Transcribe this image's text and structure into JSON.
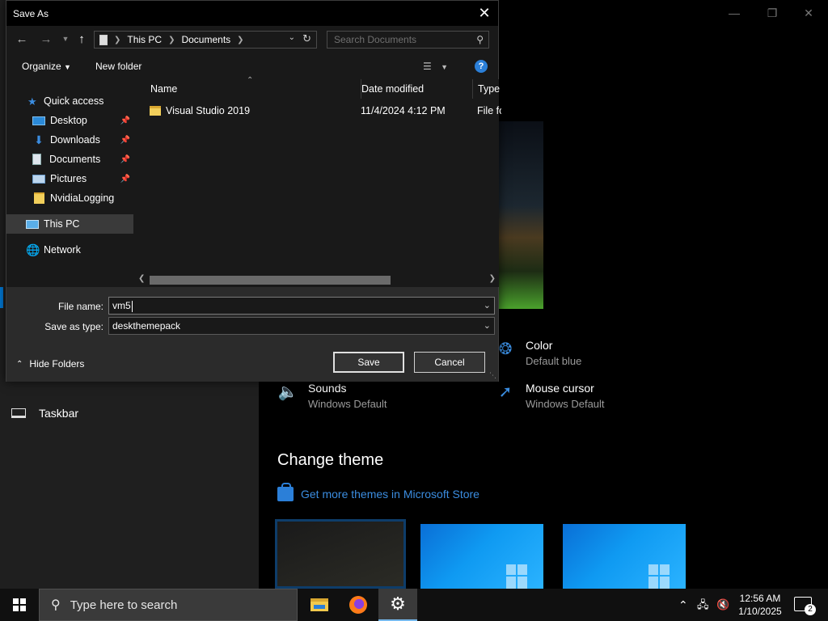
{
  "settings": {
    "nav": {
      "taskbar_label": "Taskbar"
    },
    "color": {
      "title": "Color",
      "value": "Default blue"
    },
    "sounds": {
      "title": "Sounds",
      "value": "Windows Default"
    },
    "mouse_cursor": {
      "title": "Mouse cursor",
      "value": "Windows Default"
    },
    "change_theme_heading": "Change theme",
    "store_link": "Get more themes in Microsoft Store"
  },
  "dialog": {
    "title": "Save As",
    "breadcrumb": [
      "This PC",
      "Documents"
    ],
    "search_placeholder": "Search Documents",
    "toolbar": {
      "organize": "Organize",
      "new_folder": "New folder",
      "help": "?"
    },
    "nav_pane": [
      {
        "label": "Quick access",
        "icon": "star-icon"
      },
      {
        "label": "Desktop",
        "icon": "desktop-icon",
        "pinned": true
      },
      {
        "label": "Downloads",
        "icon": "download-icon",
        "pinned": true
      },
      {
        "label": "Documents",
        "icon": "document-icon",
        "pinned": true
      },
      {
        "label": "Pictures",
        "icon": "pictures-icon",
        "pinned": true
      },
      {
        "label": "NvidiaLogging",
        "icon": "folder-icon"
      },
      {
        "label": "This PC",
        "icon": "computer-icon",
        "selected": true
      },
      {
        "label": "Network",
        "icon": "network-icon"
      }
    ],
    "columns": [
      "Name",
      "Date modified",
      "Type"
    ],
    "files": [
      {
        "name": "Visual Studio 2019",
        "date_modified": "11/4/2024 4:12 PM",
        "type": "File fo"
      }
    ],
    "file_name_label": "File name:",
    "file_name_value": "vm5",
    "save_as_type_label": "Save as type:",
    "save_as_type_value": "deskthemepack",
    "hide_folders": "Hide Folders",
    "save_button": "Save",
    "cancel_button": "Cancel"
  },
  "taskbar": {
    "search_placeholder": "Type here to search",
    "time": "12:56 AM",
    "date": "1/10/2025",
    "notification_count": "2"
  },
  "colors": {
    "accent": "#0078d4",
    "link": "#3b8de0",
    "dialog_bg": "#2b2b2b",
    "pane_bg": "#191919"
  }
}
